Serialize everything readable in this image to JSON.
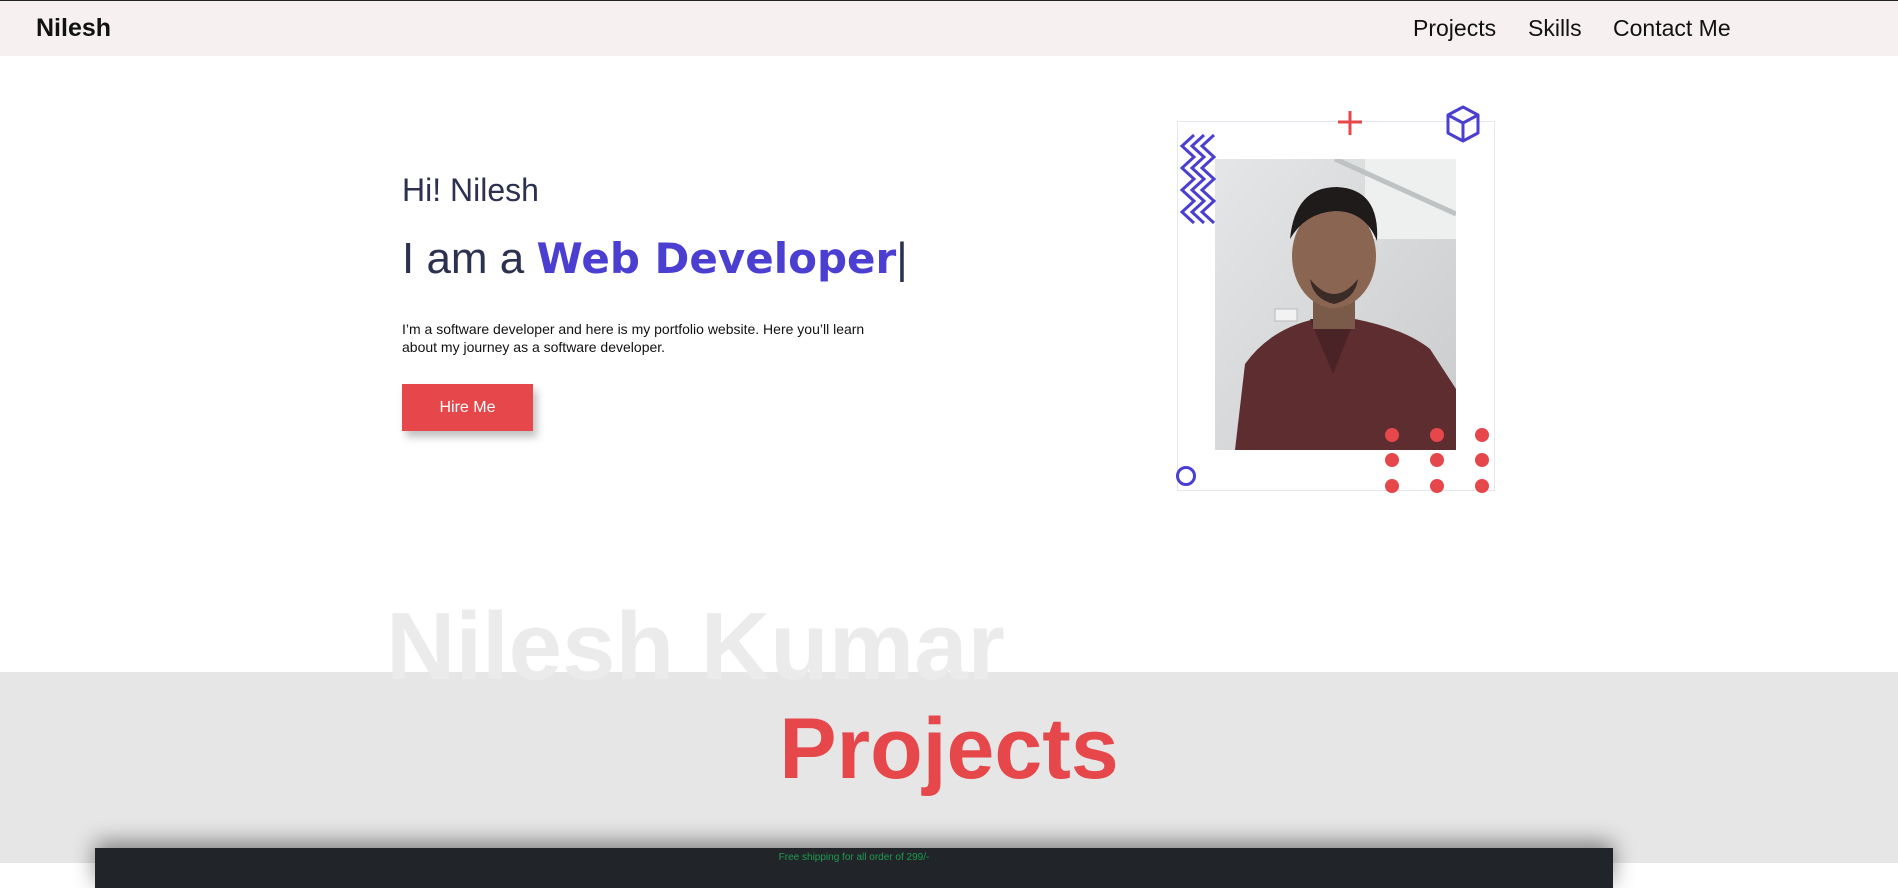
{
  "navbar": {
    "brand": "Nilesh",
    "links": [
      "Projects",
      "Skills",
      "Contact Me"
    ]
  },
  "hero": {
    "greeting": "Hi! Nilesh",
    "title_prefix": "I am a ",
    "role": "Web Developer",
    "caret": "|",
    "description": "I’m a software developer and here is my portfolio website. Here you’ll learn about my journey as a software developer.",
    "cta_label": "Hire Me"
  },
  "decorations": {
    "icons": [
      "zigzag-icon",
      "plus-icon",
      "cube-icon",
      "circle-icon",
      "dot-grid-icon"
    ],
    "accent_colors": {
      "primary": "#4a3fd1",
      "danger": "#e5474b"
    }
  },
  "watermark": "Nilesh Kumar",
  "projects": {
    "title": "Projects",
    "preview_banner": "Free shipping for all order of 299/-"
  }
}
